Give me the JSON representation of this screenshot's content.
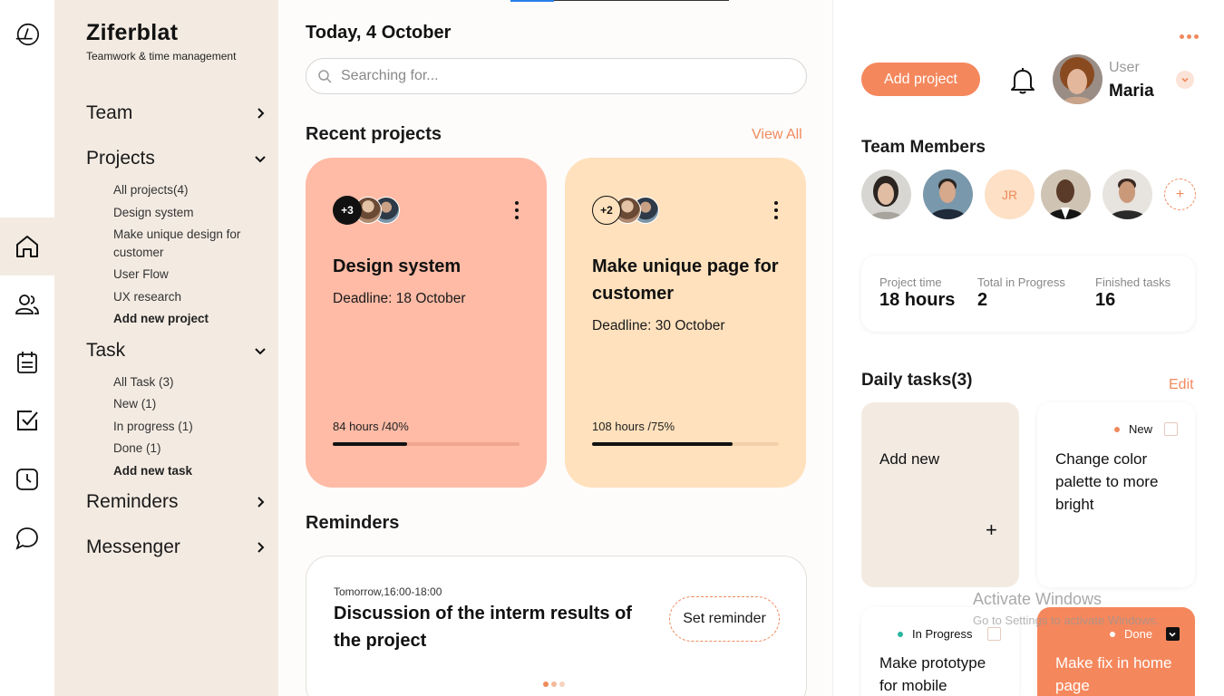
{
  "brand": {
    "name": "Ziferblat",
    "tagline": "Teamwork & time management"
  },
  "rail": {
    "icons": [
      "logo-icon",
      "home-icon",
      "users-icon",
      "calendar-icon",
      "checkbox-icon",
      "clock-icon",
      "chat-icon"
    ],
    "active": "home-icon"
  },
  "sidebar": {
    "team": "Team",
    "projects": {
      "label": "Projects",
      "items": [
        "All projects(4)",
        "Design system",
        "Make unique design for customer",
        "User Flow",
        "UX research"
      ],
      "add": "Add new project"
    },
    "task": {
      "label": "Task",
      "items": [
        "All Task (3)",
        "New (1)",
        "In progress (1)",
        "Done (1)"
      ],
      "add": "Add new task"
    },
    "reminders": "Reminders",
    "messenger": "Messenger"
  },
  "main": {
    "date": "Today, 4 October",
    "search_placeholder": "Searching for...",
    "recent_title": "Recent projects",
    "view_all": "View All",
    "projects": [
      {
        "title": "Design system",
        "deadline": "Deadline: 18 October",
        "extra_members": "+3",
        "hours": "84 hours /40%",
        "progress": 0.4,
        "bg": "#ffbba6",
        "track": "#f0a591"
      },
      {
        "title": "Make unique page for customer",
        "deadline": "Deadline: 30 October",
        "extra_members": "+2",
        "hours": "108 hours /75%",
        "progress": 0.75,
        "bg": "#ffe1bd",
        "track": "#f3cfaa"
      }
    ],
    "reminders_title": "Reminders",
    "reminder": {
      "time": "Tomorrow,16:00-18:00",
      "title": "Discussion of the interm results of the project",
      "button": "Set reminder"
    }
  },
  "right": {
    "add_project": "Add project",
    "user_role": "User",
    "user_name": "Maria",
    "team_title": "Team Members",
    "member_initials": "JR",
    "stats": [
      {
        "label": "Project time",
        "value": "18 hours"
      },
      {
        "label": "Total in Progress",
        "value": "2"
      },
      {
        "label": "Finished tasks",
        "value": "16"
      }
    ],
    "daily_title": "Daily tasks(3)",
    "edit": "Edit",
    "add_new": "Add new",
    "add_symbol": "+",
    "tasks": [
      {
        "status": "New",
        "text": "Change color palette to more bright"
      },
      {
        "status": "In Progress",
        "text": "Make prototype for mobile"
      },
      {
        "status": "Done",
        "text": "Make fix in home page"
      }
    ],
    "colors": {
      "accent": "#f5875c",
      "new_dot": "#f08a5d",
      "progress_dot": "#2bb5a0"
    }
  },
  "watermark": {
    "line1": "Activate Windows",
    "line2": "Go to Settings to activate Windows."
  }
}
